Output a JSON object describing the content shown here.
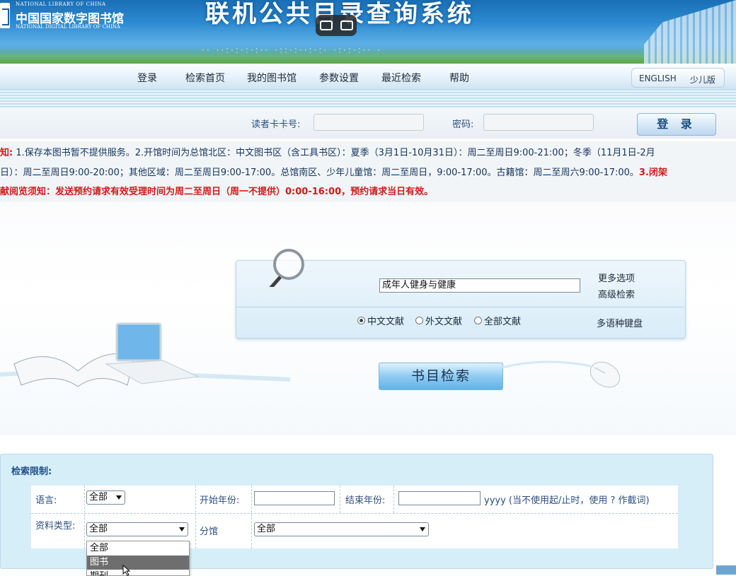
{
  "banner": {
    "en_top": "NATIONAL LIBRARY OF CHINA",
    "cn_name": "中国国家数字图书馆",
    "en_bottom": "NATIONAL DIGITAL LIBRARY OF CHINA",
    "system_title": "联机公共目录查询系统"
  },
  "nav": {
    "items": [
      "登录",
      "检索首页",
      "我的图书馆",
      "参数设置",
      "最近检索",
      "帮助"
    ],
    "lang_english": "ENGLISH",
    "lang_kids": "少儿版"
  },
  "login": {
    "card_label": "读者卡卡号:",
    "password_label": "密码:",
    "button_label": "登 录"
  },
  "notice": {
    "line1_prefix": "知:",
    "line1": "1.保存本图书暂不提供服务。2.开馆时间为总馆北区：中文图书区（含工具书区）：夏季（3月1日-10月31日）：周二至周日9:00-21:00；冬季（11月1日-2月",
    "line2": "日）：周二至周日9:00-20:00；其他区域：周二至周日9:00-17:00。总馆南区、少年儿童馆：周二至周日，9:00-17:00。古籍馆：周二至周六9:00-17:00。",
    "line2_red": "3.闭架",
    "line3": "献阅览须知：发送预约请求有效受理时间为周二至周日（周一不提供）0:00-16:00，预约请求当日有效。"
  },
  "search": {
    "query": "成年人健身与健康",
    "more_options": "更多选项",
    "advanced": "高级检索",
    "multilang_keyboard": "多语种键盘",
    "radio_options": [
      "中文文献",
      "外文文献",
      "全部文献"
    ],
    "radio_selected": "中文文献",
    "submit_label": "书目检索"
  },
  "limits": {
    "title": "检索限制:",
    "language_label": "语言:",
    "language_value": "全部",
    "start_year_label": "开始年份:",
    "end_year_label": "结束年份:",
    "year_note": "yyyy (当不使用起/止时，使用 ? 作截词)",
    "type_label": "资料类型:",
    "type_value": "全部",
    "branch_label": "分馆",
    "branch_value": "全部",
    "type_options": [
      "全部",
      "图书",
      "期刊"
    ],
    "type_highlighted": "图书"
  }
}
